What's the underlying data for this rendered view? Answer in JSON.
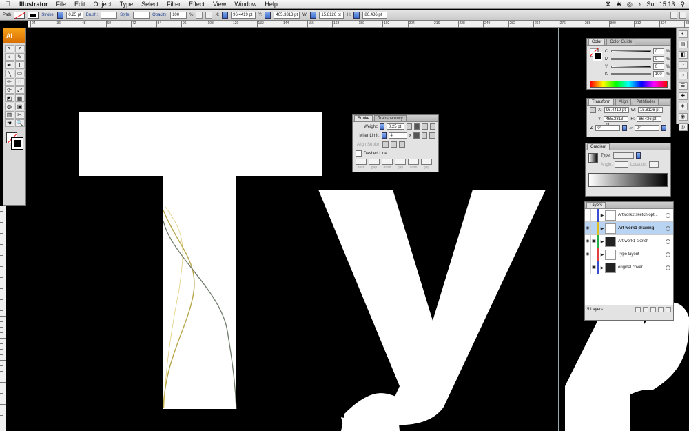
{
  "menubar": {
    "apple": "",
    "app": "Illustrator",
    "items": [
      "File",
      "Edit",
      "Object",
      "Type",
      "Select",
      "Filter",
      "Effect",
      "View",
      "Window",
      "Help"
    ],
    "clock": "Sun 15:13"
  },
  "controlbar": {
    "selection": "Path",
    "stroke_label": "Stroke:",
    "stroke_weight": "0.25 pt",
    "brush_label": "Brush:",
    "style_label": "Style:",
    "opacity_label": "Opacity:",
    "opacity": "100",
    "opacity_unit": "%",
    "x_label": "X:",
    "x_value": "96.4419 pt",
    "y_label": "Y:",
    "y_value": "465.3313 pt",
    "w_label": "W:",
    "w_value": "15.8126 pt",
    "h_label": "H:",
    "h_value": "86.436 pt"
  },
  "ruler_top": [
    "24",
    "36",
    "48",
    "60",
    "72",
    "84",
    "96",
    "108",
    "120",
    "132",
    "144",
    "156",
    "168",
    "180",
    "192",
    "204",
    "216",
    "228",
    "240",
    "252",
    "264",
    "276",
    "288",
    "300",
    "312",
    "324",
    "336"
  ],
  "tools": {
    "badge": "Ai",
    "glyphs": [
      "↖",
      "↗",
      "⌖",
      "✎",
      "✒",
      "T",
      "╲",
      "▭",
      "✏",
      "◌",
      "⟳",
      "⤢",
      "◩",
      "▦",
      "◍",
      "▣",
      "▥",
      "✂",
      "☚",
      "🔍"
    ]
  },
  "dock": [
    "◐",
    "▤",
    "◧",
    "◔",
    "◑",
    "☰",
    "✚",
    "❖",
    "◉",
    "◎"
  ],
  "canvas": {
    "letters": [
      "T",
      "y",
      "p"
    ],
    "colors": {
      "background": "#000000",
      "letters": "#ffffff",
      "path_primary": "#b8a64a",
      "path_secondary": "#8fa089"
    }
  },
  "stroke_panel": {
    "tabs": [
      "Stroke",
      "Transparency"
    ],
    "weight_label": "Weight:",
    "weight": "0.25 pt",
    "miter_label": "Miter Limit:",
    "miter": "4",
    "miter_unit": "x",
    "align_label": "Align Stroke:",
    "dashed_label": "Dashed Line",
    "dash_labels": [
      "dash",
      "gap",
      "dash",
      "gap",
      "dash",
      "gap"
    ]
  },
  "color_panel": {
    "tabs": [
      "Color",
      "Color Guide"
    ],
    "channels": [
      {
        "name": "C",
        "value": "0"
      },
      {
        "name": "M",
        "value": "0"
      },
      {
        "name": "Y",
        "value": "0"
      },
      {
        "name": "K",
        "value": "100"
      }
    ],
    "unit": "%"
  },
  "transform_panel": {
    "tabs": [
      "Transform",
      "Align",
      "Pathfinder"
    ],
    "x_label": "X:",
    "x": "96.4419 pt",
    "y_label": "Y:",
    "y": "465.3313 pt",
    "w_label": "W:",
    "w": "15.8126 pt",
    "h_label": "H:",
    "h": "86.436 pt",
    "rotate": "0°",
    "shear": "0°"
  },
  "gradient_panel": {
    "tabs": [
      "Gradient"
    ],
    "type_label": "Type:",
    "angle_label": "Angle:",
    "location_label": "Location:"
  },
  "layers_panel": {
    "tabs": [
      "Layers"
    ],
    "layers": [
      {
        "name": "Artwork2 sketch opt...",
        "visible": false,
        "locked": false,
        "color": "#3a4fd0",
        "dark": false
      },
      {
        "name": "Art work1 drawing",
        "visible": true,
        "locked": false,
        "color": "#e0c020",
        "dark": false,
        "selected": true
      },
      {
        "name": "Art work1 sketch",
        "visible": true,
        "locked": true,
        "color": "#26b04a",
        "dark": true
      },
      {
        "name": "Type layout",
        "visible": true,
        "locked": false,
        "color": "#e04040",
        "dark": false
      },
      {
        "name": "original cover",
        "visible": false,
        "locked": true,
        "color": "#3a4fd0",
        "dark": true
      }
    ],
    "count": "5 Layers"
  }
}
